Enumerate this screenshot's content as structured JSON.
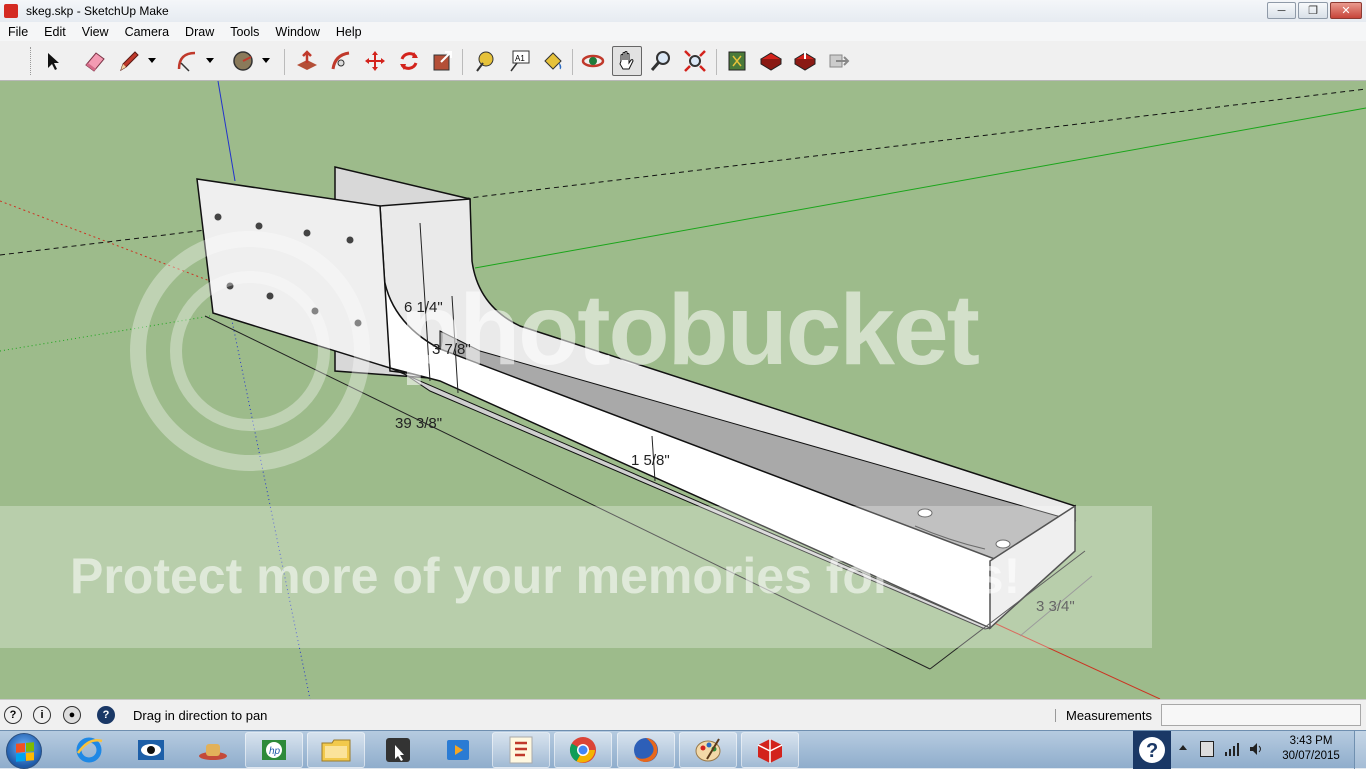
{
  "window": {
    "title": "skeg.skp - SketchUp Make"
  },
  "menu": [
    "File",
    "Edit",
    "View",
    "Camera",
    "Draw",
    "Tools",
    "Window",
    "Help"
  ],
  "toolbar": {
    "tools": [
      "select-tool",
      "eraser-tool",
      "pencil-tool",
      "arc-tool",
      "circle-tool",
      "push-pull-tool",
      "follow-me-tool",
      "move-tool",
      "rotate-tool",
      "scale-tool",
      "tape-measure-tool",
      "text-tool",
      "paint-bucket-tool",
      "orbit-tool",
      "pan-tool",
      "zoom-tool",
      "zoom-extents-tool",
      "3d-warehouse-tool",
      "extension-warehouse-tool",
      "share-model-tool",
      "preview-model-tool"
    ],
    "active_tool": "pan-tool"
  },
  "viewport": {
    "background_color": "#9dbb8b",
    "dimensions": {
      "height": "6 1/4\"",
      "radius": "3 7/8\"",
      "length": "39 3/8\"",
      "channel_depth": "1 5/8\"",
      "width": "3 3/4\""
    },
    "watermark": {
      "brand": "photobucket",
      "banner": "Protect more of your memories for less!"
    }
  },
  "status": {
    "message": "Drag in direction to pan",
    "measurements_label": "Measurements",
    "measurements_value": ""
  },
  "taskbar": {
    "apps": [
      "internet-explorer",
      "app-eye",
      "app-hat",
      "hp",
      "file-explorer",
      "app-media-center",
      "media-player",
      "app-red",
      "chrome",
      "firefox",
      "paint",
      "sketchup"
    ],
    "clock": {
      "time": "3:43 PM",
      "date": "30/07/2015"
    }
  }
}
